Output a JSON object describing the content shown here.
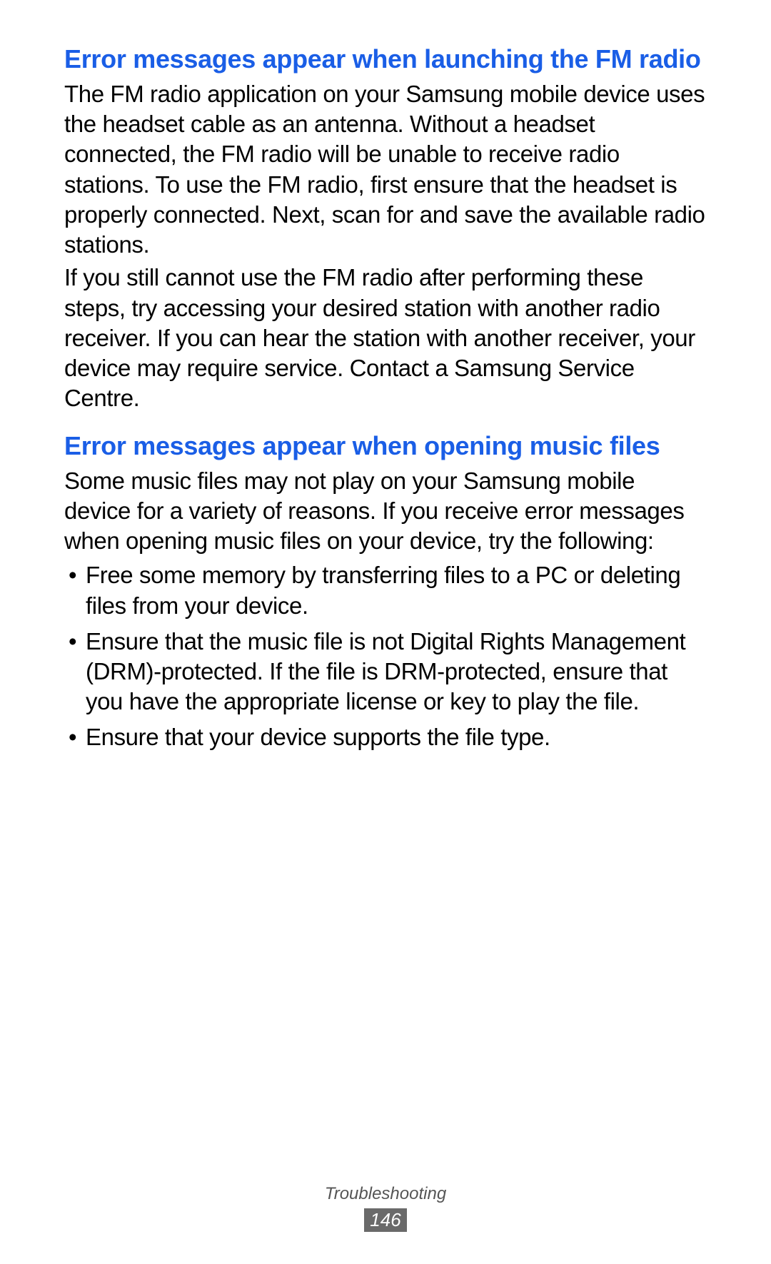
{
  "sections": [
    {
      "heading": "Error messages appear when launching the FM radio",
      "paragraphs": [
        "The FM radio application on your Samsung mobile device uses the headset cable as an antenna. Without a headset connected, the FM radio will be unable to receive radio stations. To use the FM radio, first ensure that the headset is properly connected. Next, scan for and save the available radio stations.",
        "If you still cannot use the FM radio after performing these steps, try accessing your desired station with another radio receiver. If you can hear the station with another receiver, your device may require service. Contact a Samsung Service Centre."
      ],
      "bullets": []
    },
    {
      "heading": "Error messages appear when opening music files",
      "paragraphs": [
        "Some music files may not play on your Samsung mobile device for a variety of reasons. If you receive error messages when opening music files on your device, try the following:"
      ],
      "bullets": [
        "Free some memory by transferring files to a PC or deleting files from your device.",
        "Ensure that the music file is not Digital Rights Management (DRM)-protected. If the file is DRM-protected, ensure that you have the appropriate license or key to play the file.",
        "Ensure that your device supports the file type."
      ]
    }
  ],
  "footer": {
    "section_name": "Troubleshooting",
    "page_number": "146"
  }
}
